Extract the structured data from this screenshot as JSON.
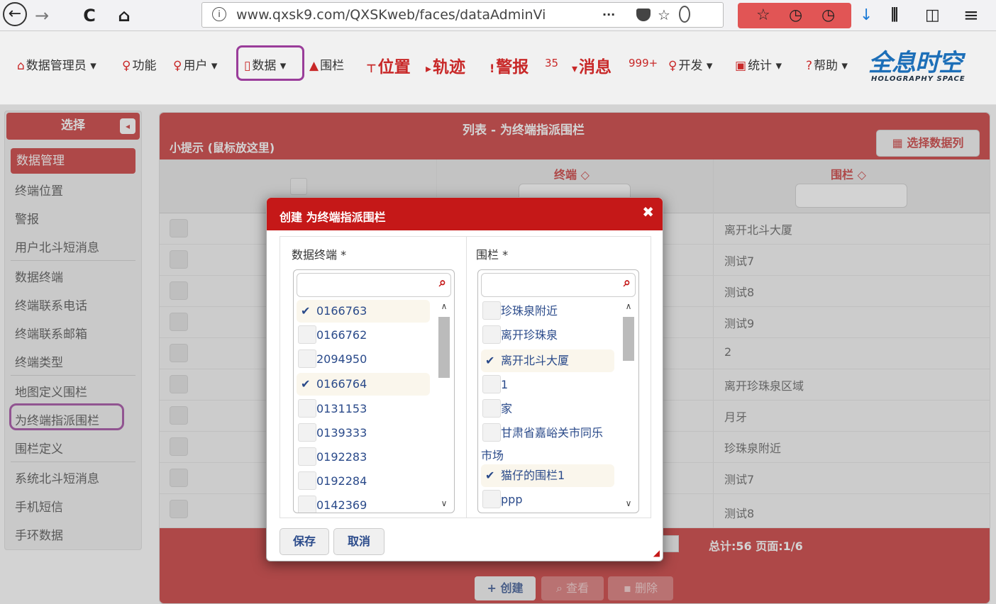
{
  "browser": {
    "back": "←",
    "forward": "→",
    "reload": "C",
    "home": "⌂",
    "url": "www.qxsk9.com/QXSKweb/faces/dataAdminVi",
    "more": "···",
    "downloads_icon": "download-icon",
    "library": "⫼",
    "sidebar": "◫",
    "menu": "≡"
  },
  "nav": {
    "items": [
      {
        "label": "数据管理员 ▾",
        "icon": "⌂"
      },
      {
        "label": "功能",
        "icon": "♀"
      },
      {
        "label": "用户 ▾",
        "icon": "♀"
      },
      {
        "label": "数据 ▾",
        "icon": "▯"
      },
      {
        "label": "围栏",
        "icon": "▲"
      },
      {
        "label": "位置",
        "icon": "⊤"
      },
      {
        "label": "轨迹",
        "icon": "▸"
      },
      {
        "label": "警报",
        "icon": "!"
      },
      {
        "label": "消息",
        "icon": "▾"
      },
      {
        "label": "开发 ▾",
        "icon": "♀"
      },
      {
        "label": "统计 ▾",
        "icon": "▣"
      },
      {
        "label": "帮助 ▾",
        "icon": "?"
      }
    ],
    "alarm_count": "35",
    "message_count": "999+",
    "logo_main": "全息时空",
    "logo_sub": "HOLOGRAPHY SPACE"
  },
  "sidebar": {
    "header": "选择",
    "toggle": "◂",
    "active": "数据管理",
    "items": [
      "终端位置",
      "警报",
      "用户北斗短消息",
      "数据终端",
      "终端联系电话",
      "终端联系邮箱",
      "终端类型",
      "地图定义围栏",
      "为终端指派围栏",
      "围栏定义",
      "系统北斗短消息",
      "手机短信",
      "手环数据"
    ]
  },
  "panel": {
    "title": "列表 - 为终端指派围栏",
    "tip": "小提示 (鼠标放这里)",
    "select_columns": "▦ 选择数据列",
    "col_terminal": "终端 ◇",
    "col_fence": "围栏 ◇",
    "rows": [
      "离开北斗大厦",
      "测试7",
      "测试8",
      "测试9",
      "2",
      "离开珍珠泉区域",
      "月牙",
      "珍珠泉附近",
      "测试7",
      "测试8"
    ],
    "pager": "总计:56 页面:1/6",
    "btn_create": "+ 创建",
    "btn_view": "⌕ 查看",
    "btn_delete": "▪ 删除"
  },
  "dialog": {
    "title": "创建 为终端指派围栏",
    "close": "✖",
    "label_terminal": "数据终端 *",
    "label_fence": "围栏 *",
    "search_icon": "⌕",
    "terminals": [
      {
        "text": "0166763",
        "checked": true
      },
      {
        "text": "0166762",
        "checked": false
      },
      {
        "text": "2094950",
        "checked": false
      },
      {
        "text": "0166764",
        "checked": true
      },
      {
        "text": "0131153",
        "checked": false
      },
      {
        "text": "0139333",
        "checked": false
      },
      {
        "text": "0192283",
        "checked": false
      },
      {
        "text": "0192284",
        "checked": false
      },
      {
        "text": "0142369",
        "checked": false
      }
    ],
    "fences": [
      {
        "text": "珍珠泉附近",
        "checked": false
      },
      {
        "text": "离开珍珠泉",
        "checked": false
      },
      {
        "text": "离开北斗大厦",
        "checked": true
      },
      {
        "text": "1",
        "checked": false
      },
      {
        "text": "家",
        "checked": false
      },
      {
        "text": "甘肃省嘉峪关市同乐",
        "checked": false
      },
      {
        "text": "市场",
        "checked": false
      },
      {
        "text": "猫仔的围栏1",
        "checked": true
      },
      {
        "text": "ppp",
        "checked": false
      }
    ],
    "check_mark": "✔",
    "save": "保存",
    "cancel": "取消"
  }
}
